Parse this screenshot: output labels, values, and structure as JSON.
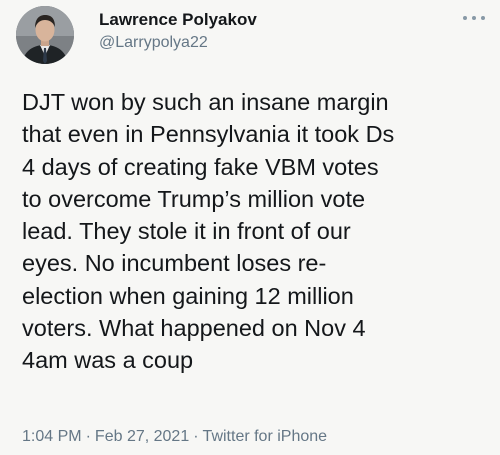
{
  "tweet": {
    "author": {
      "display_name": "Lawrence Polyakov",
      "handle": "@Larrypolya22"
    },
    "text_lines": [
      "DJT won by such an insane margin",
      "that even in Pennsylvania it took Ds",
      "4 days of creating fake VBM votes",
      "to overcome Trump’s million vote",
      "lead. They stole it in front of our",
      "eyes. No incumbent loses re-",
      "election when gaining 12 million",
      "voters. What happened on Nov 4",
      "4am was a coup"
    ],
    "time": "1:04 PM",
    "date": "Feb 27, 2021",
    "separator": "·",
    "source": "Twitter for iPhone"
  }
}
